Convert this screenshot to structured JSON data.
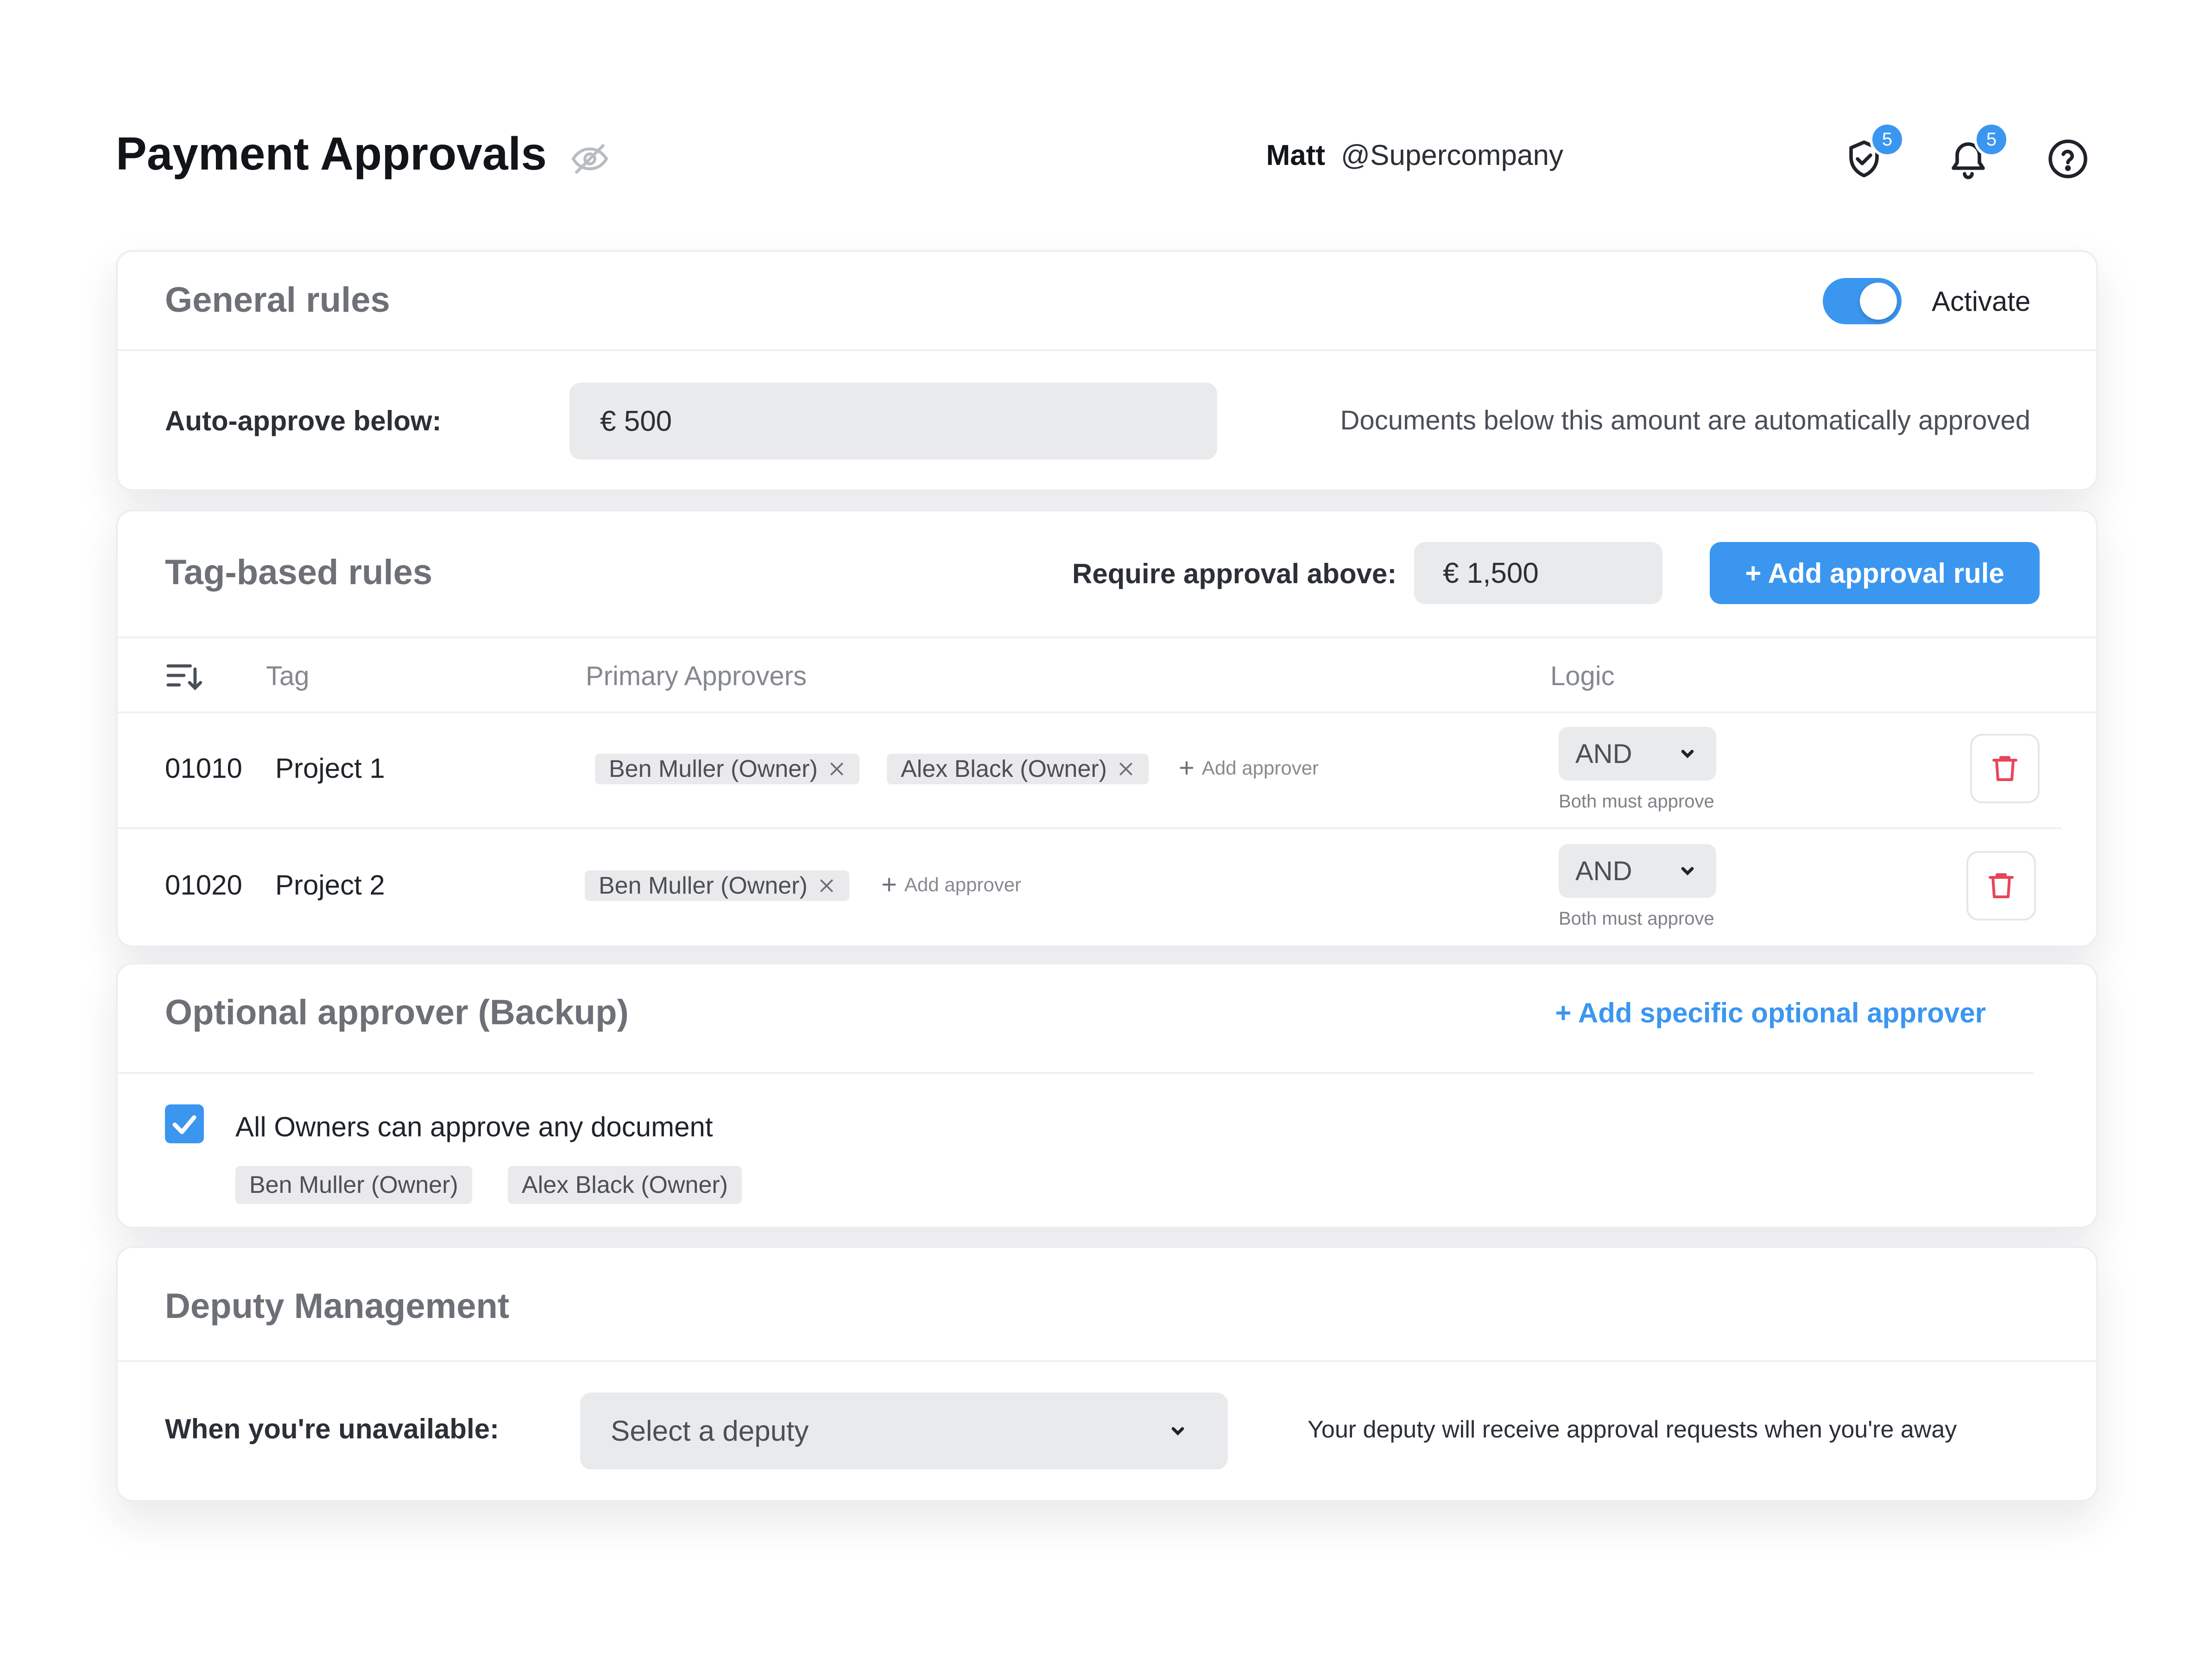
{
  "header": {
    "title": "Payment Approvals",
    "user_name": "Matt",
    "company": "@Supercompany",
    "approvals_badge": "5",
    "notifications_badge": "5"
  },
  "general_rules": {
    "title": "General rules",
    "toggle_label": "Activate",
    "auto_approve_label": "Auto-approve below:",
    "auto_approve_value": "€ 500",
    "auto_approve_hint": "Documents below this amount are automatically approved"
  },
  "tag_rules": {
    "title": "Tag-based rules",
    "require_label": "Require approval above:",
    "require_value": "€ 1,500",
    "add_rule_button": "+  Add approval rule",
    "columns": {
      "tag": "Tag",
      "approvers": "Primary Approvers",
      "logic": "Logic"
    },
    "add_approver_label": "Add approver",
    "rows": [
      {
        "code": "01010",
        "name": "Project 1",
        "approvers": [
          "Ben Muller (Owner)",
          "Alex Black (Owner)"
        ],
        "logic": "AND",
        "logic_note": "Both must approve"
      },
      {
        "code": "01020",
        "name": "Project 2",
        "approvers": [
          "Ben Muller (Owner)"
        ],
        "logic": "AND",
        "logic_note": "Both must approve"
      }
    ]
  },
  "optional_approver": {
    "title": "Optional approver (Backup)",
    "add_link": "+  Add specific optional approver",
    "checkbox_label": "All Owners can approve any document",
    "checked": true,
    "owners": [
      "Ben Muller (Owner)",
      "Alex Black (Owner)"
    ]
  },
  "deputy": {
    "title": "Deputy Management",
    "label": "When you're unavailable:",
    "select_placeholder": "Select a deputy",
    "hint": "Your deputy will receive approval requests when you're away"
  },
  "colors": {
    "accent": "#3b96f0",
    "danger": "#e8455a",
    "chip_bg": "#eaeaec"
  }
}
